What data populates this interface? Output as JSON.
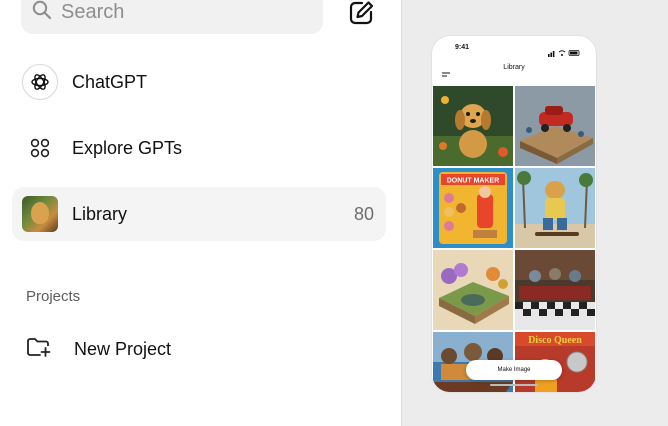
{
  "search": {
    "placeholder": "Search"
  },
  "nav": {
    "chatgpt": {
      "label": "ChatGPT"
    },
    "explore": {
      "label": "Explore GPTs"
    },
    "library": {
      "label": "Library",
      "count": "80"
    }
  },
  "projects": {
    "section_title": "Projects",
    "new_project_label": "New Project"
  },
  "phone": {
    "status_time": "9:41",
    "header_title": "Library",
    "tiles": [
      {
        "name": "golden-retriever-puppy",
        "text": ""
      },
      {
        "name": "red-car-diorama",
        "text": ""
      },
      {
        "name": "donut-maker-toy",
        "text": "DONUT MAKER"
      },
      {
        "name": "skateboarding-cat",
        "text": ""
      },
      {
        "name": "garden-diorama",
        "text": ""
      },
      {
        "name": "diner-diorama",
        "text": ""
      },
      {
        "name": "family-boat",
        "text": ""
      },
      {
        "name": "disco-queen-poster",
        "text": "Disco Queen"
      }
    ],
    "make_image_label": "Make Image"
  },
  "colors": {
    "sidebar_bg": "#ffffff",
    "page_bg": "#ececec",
    "active_item_bg": "#f4f4f4",
    "search_bg": "#f1f1f1"
  },
  "icons": {
    "search": "search-icon",
    "compose": "compose-icon",
    "chatgpt": "openai-logo-icon",
    "explore": "grid-dots-icon",
    "new_project": "folder-plus-icon"
  }
}
